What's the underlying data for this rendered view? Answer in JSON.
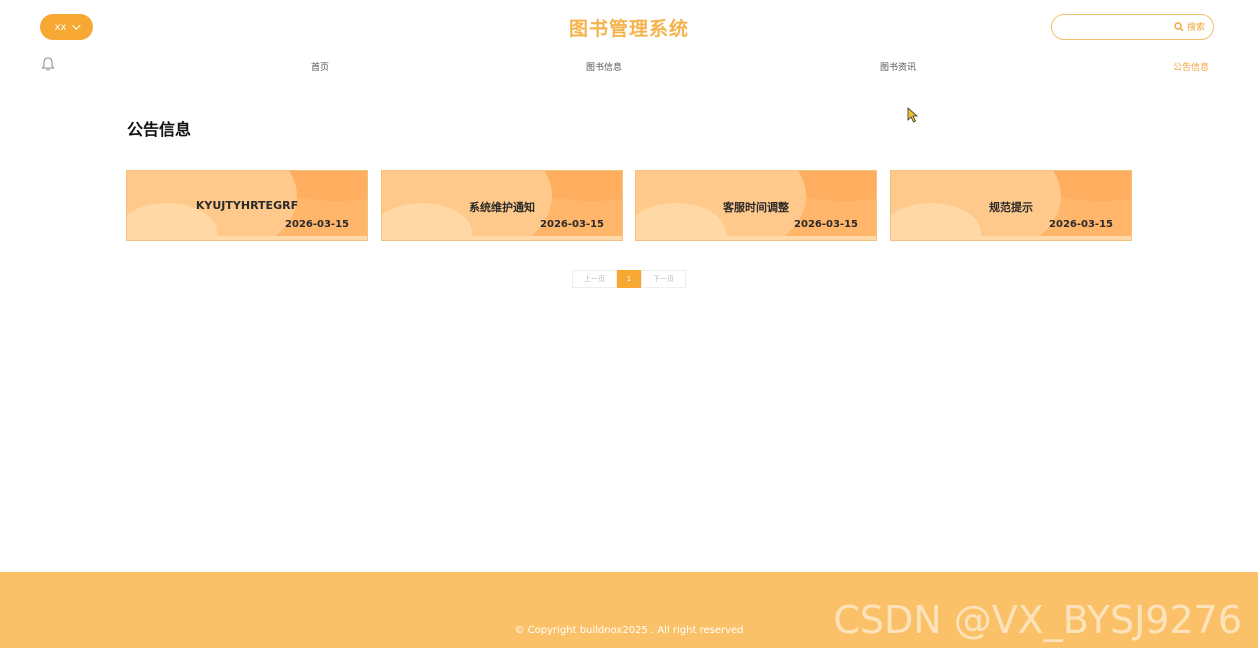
{
  "header": {
    "user_label": "xx",
    "site_title": "图书管理系统",
    "search": {
      "placeholder": "",
      "button_label": "搜索"
    }
  },
  "nav": {
    "items": [
      {
        "label": "首页"
      },
      {
        "label": "图书信息"
      },
      {
        "label": "图书资讯"
      },
      {
        "label": "公告信息"
      }
    ],
    "active_index": 3
  },
  "main": {
    "section_title": "公告信息",
    "cards": [
      {
        "title": "KYUJTYHRTEGRF",
        "date": "2026-03-15"
      },
      {
        "title": "系统维护通知",
        "date": "2026-03-15"
      },
      {
        "title": "客服时间调整",
        "date": "2026-03-15"
      },
      {
        "title": "规范提示",
        "date": "2026-03-15"
      }
    ],
    "pagination": {
      "prev_label": "上一页",
      "current_page": "1",
      "next_label": "下一页"
    }
  },
  "footer": {
    "copyright": "© Copyright buildnox2025 . All right reserved",
    "watermark": "CSDN @VX_BYSJ9276"
  },
  "colors": {
    "accent": "#f6a833",
    "title": "#f6b34c",
    "card": "#ffb66a",
    "footer": "#fbc168"
  }
}
